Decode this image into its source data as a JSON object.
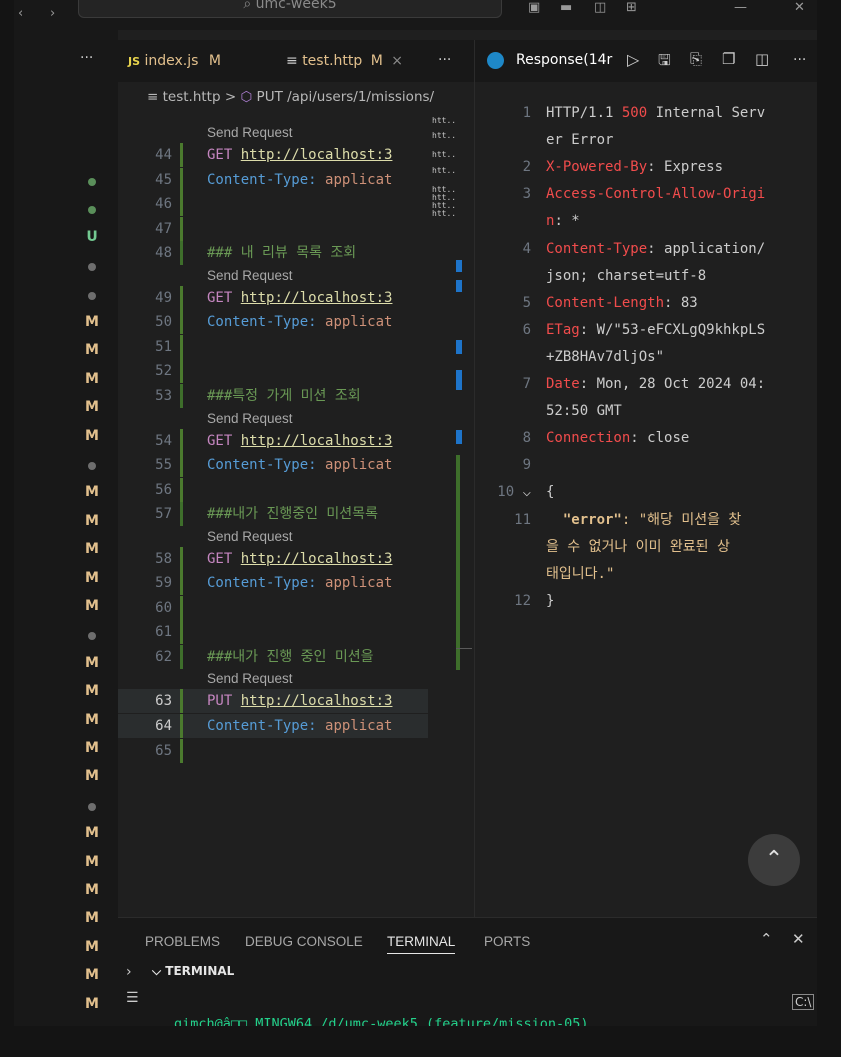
{
  "window": {
    "search_text": "umc-week5"
  },
  "tabs": [
    {
      "icon": "JS",
      "label": "index.js",
      "badge": "M"
    },
    {
      "icon": "≡",
      "label": "test.http",
      "badge": "M",
      "close": "×"
    }
  ],
  "tab_overflow": "···",
  "sidebar_more": "···",
  "breadcrumb": {
    "file": "test.http",
    "sep": ">",
    "symbol": "PUT /api/users/1/missions/"
  },
  "activity_status": [
    "U",
    "M",
    "M",
    "M",
    "M",
    "M",
    "M",
    "M",
    "M",
    "M",
    "M",
    "M",
    "M",
    "M",
    "M",
    "M",
    "M",
    "M",
    "M"
  ],
  "editor": {
    "send_request": "Send Request",
    "lines": [
      {
        "n": "44",
        "method": "GET",
        "url": "http://localhost:3"
      },
      {
        "n": "45",
        "header": "Content-Type:",
        "value": "applicat"
      },
      {
        "n": "46"
      },
      {
        "n": "47"
      },
      {
        "n": "48",
        "comment": "### 내 리뷰 목록 조회"
      },
      {
        "n": "49",
        "method": "GET",
        "url": "http://localhost:3"
      },
      {
        "n": "50",
        "header": "Content-Type:",
        "value": "applicat"
      },
      {
        "n": "51"
      },
      {
        "n": "52"
      },
      {
        "n": "53",
        "comment": "###특정 가게 미션 조회"
      },
      {
        "n": "54",
        "method": "GET",
        "url": "http://localhost:3"
      },
      {
        "n": "55",
        "header": "Content-Type:",
        "value": "applicat"
      },
      {
        "n": "56"
      },
      {
        "n": "57",
        "comment": "###내가 진행중인 미션목록"
      },
      {
        "n": "58",
        "method": "GET",
        "url": "http://localhost:3"
      },
      {
        "n": "59",
        "header": "Content-Type:",
        "value": "applicat"
      },
      {
        "n": "60"
      },
      {
        "n": "61"
      },
      {
        "n": "62",
        "comment": "###내가 진행 중인 미션을"
      },
      {
        "n": "63",
        "method": "PUT",
        "url": "http://localhost:3"
      },
      {
        "n": "64",
        "header": "Content-Type:",
        "value": "applicat"
      },
      {
        "n": "65"
      }
    ]
  },
  "minimap": [
    "htt..",
    "htt..",
    "htt..",
    "htt..",
    "htt..",
    "htt..",
    "htt..",
    "htt.."
  ],
  "response": {
    "tab_label": "Response(14r",
    "lines": [
      {
        "n": "1",
        "text": "HTTP/1.1 ",
        "status": "500",
        "rest": " Internal Serv"
      },
      {
        "n": "",
        "text": "er Error"
      },
      {
        "n": "2",
        "key": "X-Powered-By",
        "value": ": Express"
      },
      {
        "n": "3",
        "key": "Access-Control-Allow-Origi"
      },
      {
        "n": "",
        "key": "n",
        "value": ": *"
      },
      {
        "n": "4",
        "key": "Content-Type",
        "value": ": application/"
      },
      {
        "n": "",
        "text": "json; charset=utf-8"
      },
      {
        "n": "5",
        "key": "Content-Length",
        "value": ": 83"
      },
      {
        "n": "6",
        "key": "ETag",
        "value": ": W/\"53-eFCXLgQ9khkpLS"
      },
      {
        "n": "",
        "text": "+ZB8HAv7dljOs\""
      },
      {
        "n": "7",
        "key": "Date",
        "value": ": Mon, 28 Oct 2024 04:"
      },
      {
        "n": "",
        "text": "52:50 GMT"
      },
      {
        "n": "8",
        "key": "Connection",
        "value": ": close"
      },
      {
        "n": "9",
        "text": ""
      },
      {
        "n": "10",
        "text": "{"
      },
      {
        "n": "11",
        "jkey": "\"error\"",
        "jval": ": \"해당 미션을 찾"
      },
      {
        "n": "",
        "jval2": "을 수 없거나 이미 완료된 상"
      },
      {
        "n": "",
        "jval2": "태입니다.\""
      },
      {
        "n": "12",
        "text": "}"
      }
    ]
  },
  "panel": {
    "tabs": [
      "PROBLEMS",
      "DEBUG CONSOLE",
      "TERMINAL",
      "PORTS"
    ],
    "active": "TERMINAL",
    "section_title": "TERMINAL",
    "prompt": "gimch@â□□ MINGW64 /d/umc-week5 (feature/mission-05)"
  },
  "colors": {
    "status_error": "#f14c4c",
    "modified": "#e2c08d",
    "untracked": "#73c991",
    "accent": "#0078d4"
  }
}
